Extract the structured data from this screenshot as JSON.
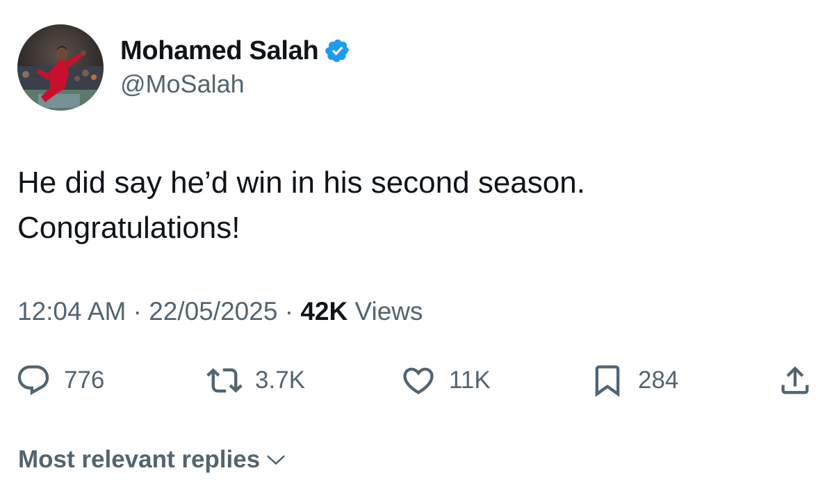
{
  "author": {
    "display_name": "Mohamed Salah",
    "handle": "@MoSalah",
    "verified": true,
    "verified_color": "#1d9bf0"
  },
  "tweet": {
    "lines": [
      "He did say he’d win in his second season.",
      "Congratulations!"
    ]
  },
  "meta": {
    "time": "12:04 AM",
    "separator": " · ",
    "date": "22/05/2025",
    "views_count": "42K",
    "views_label": " Views"
  },
  "actions": {
    "reply": {
      "icon": "reply-icon",
      "count": "776"
    },
    "repost": {
      "icon": "repost-icon",
      "count": "3.7K"
    },
    "like": {
      "icon": "heart-icon",
      "count": "11K"
    },
    "bookmark": {
      "icon": "bookmark-icon",
      "count": "284"
    },
    "share": {
      "icon": "share-icon"
    }
  },
  "replies_sort": {
    "label": "Most relevant replies",
    "icon": "chevron-down-icon"
  },
  "colors": {
    "text_primary": "#0f1419",
    "text_secondary": "#536471",
    "background": "#ffffff"
  }
}
